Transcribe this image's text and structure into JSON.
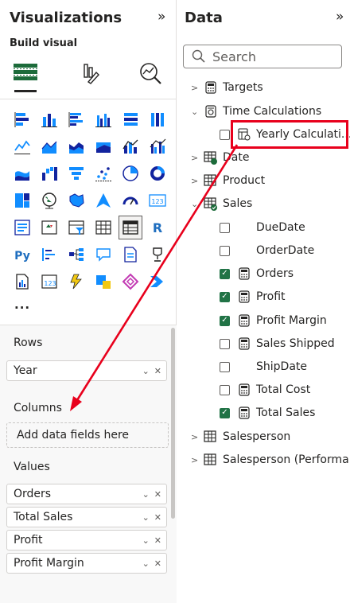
{
  "viz": {
    "title": "Visualizations",
    "expand_glyph": "»",
    "build_label": "Build visual",
    "more": "...",
    "sections": {
      "rows": "Rows",
      "columns": "Columns",
      "values": "Values"
    },
    "rows_fields": [
      "Year"
    ],
    "columns_placeholder": "Add data fields here",
    "values_fields": [
      "Orders",
      "Total Sales",
      "Profit",
      "Profit Margin"
    ]
  },
  "data": {
    "title": "Data",
    "expand_glyph": "»",
    "search_placeholder": "Search",
    "tables": {
      "targets": "Targets",
      "time_calculations": "Time Calculations",
      "yearly_calc": "Yearly Calculati...",
      "date": "Date",
      "product": "Product",
      "sales": "Sales",
      "salesperson": "Salesperson",
      "salesperson_perf": "Salesperson (Performa..."
    },
    "sales_fields": [
      {
        "label": "DueDate",
        "checked": false,
        "icon": "none"
      },
      {
        "label": "OrderDate",
        "checked": false,
        "icon": "none"
      },
      {
        "label": "Orders",
        "checked": true,
        "icon": "calculator-icon"
      },
      {
        "label": "Profit",
        "checked": true,
        "icon": "calculator-icon"
      },
      {
        "label": "Profit Margin",
        "checked": true,
        "icon": "calculator-icon"
      },
      {
        "label": "Sales Shipped",
        "checked": false,
        "icon": "calculator-icon"
      },
      {
        "label": "ShipDate",
        "checked": false,
        "icon": "none"
      },
      {
        "label": "Total Cost",
        "checked": false,
        "icon": "calculator-icon"
      },
      {
        "label": "Total Sales",
        "checked": true,
        "icon": "calculator-icon"
      }
    ]
  },
  "colors": {
    "accent_red": "#e8001c",
    "check_green": "#217346",
    "icon_blue": "#118dff",
    "icon_teal": "#12239e"
  }
}
